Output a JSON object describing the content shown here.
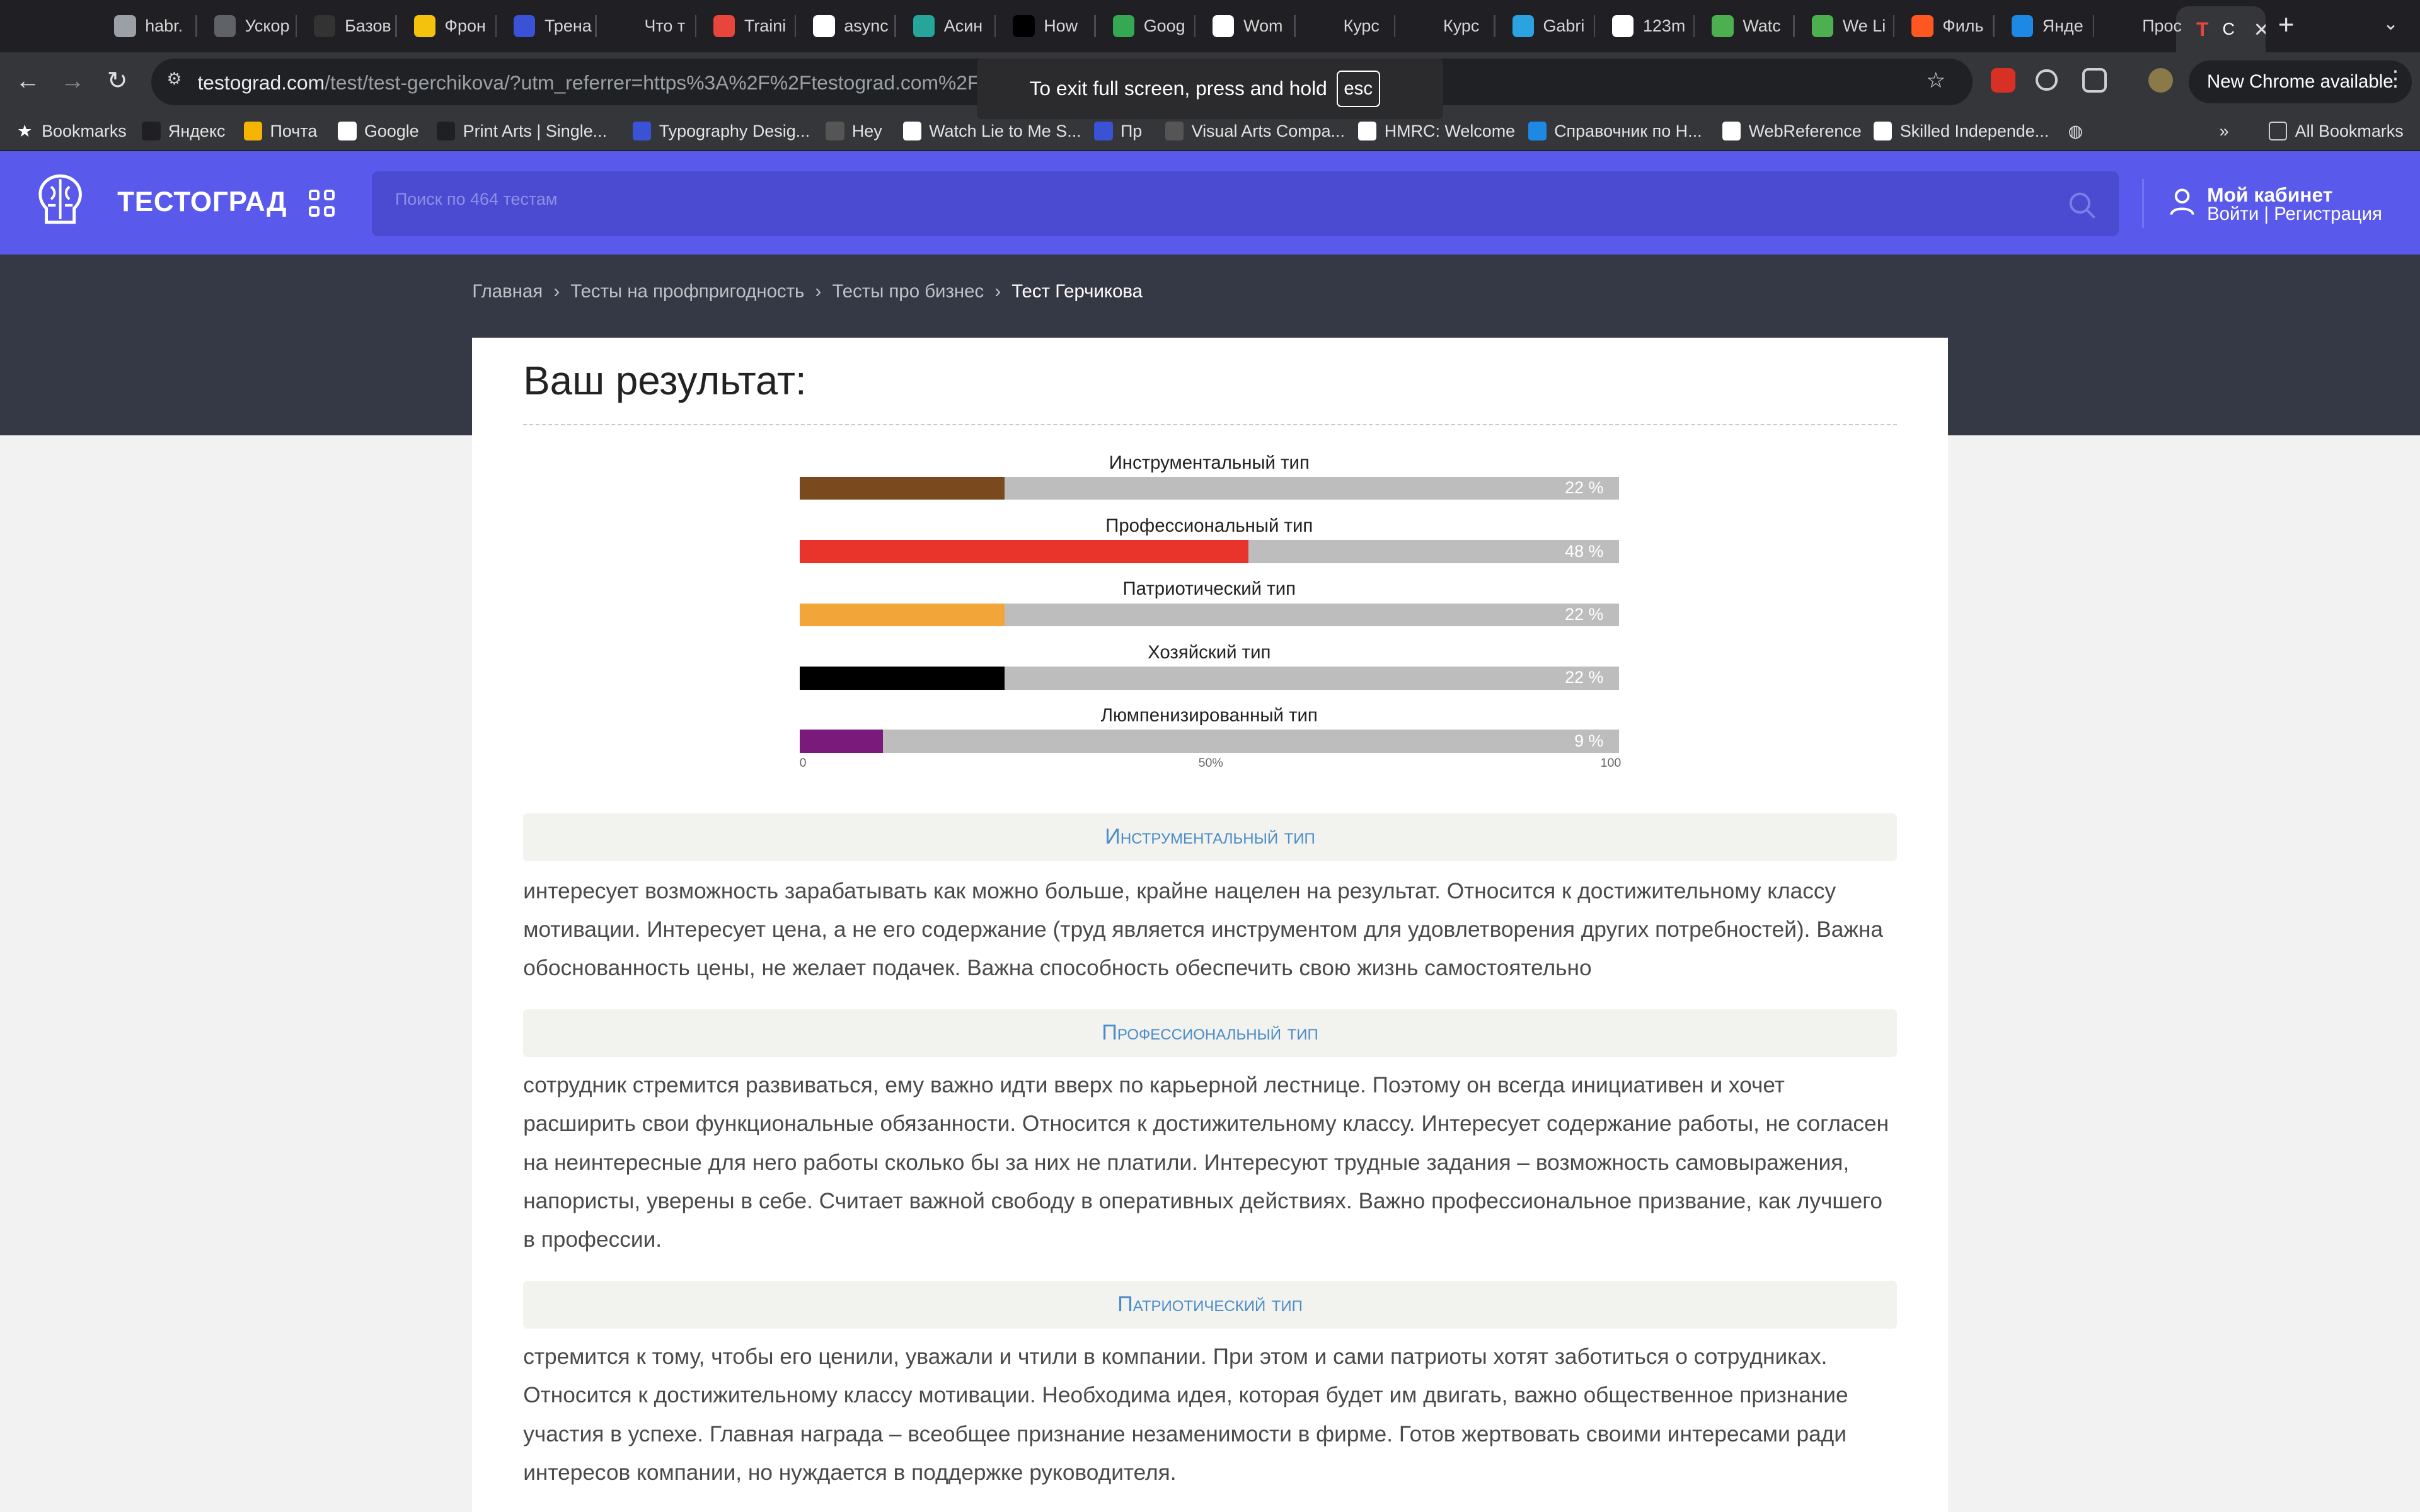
{
  "browser": {
    "tabs": [
      {
        "label": "habr.",
        "color": "#9aa0a6"
      },
      {
        "label": "Ускор",
        "color": "#5f6368"
      },
      {
        "label": "Базов",
        "color": "#333"
      },
      {
        "label": "Фрон",
        "color": "#f4c20d"
      },
      {
        "label": "Трена",
        "color": "#3a52d6"
      },
      {
        "label": "Что т",
        "color": "#1f1f24"
      },
      {
        "label": "Traini",
        "color": "#e8453c"
      },
      {
        "label": "async",
        "color": "#ffffff"
      },
      {
        "label": "Асин",
        "color": "#26a69a"
      },
      {
        "label": "How",
        "color": "#000000"
      },
      {
        "label": "Goog",
        "color": "#34a853"
      },
      {
        "label": "Wom",
        "color": "#ffffff"
      },
      {
        "label": "Курс",
        "color": "#1f1f24"
      },
      {
        "label": "Курс",
        "color": "#1f1f24"
      },
      {
        "label": "Gabri",
        "color": "#2aa3e0"
      },
      {
        "label": "123m",
        "color": "#ffffff"
      },
      {
        "label": "Watc",
        "color": "#4caf50"
      },
      {
        "label": "We Li",
        "color": "#4caf50"
      },
      {
        "label": "Филь",
        "color": "#ff5722"
      },
      {
        "label": "Янде",
        "color": "#1e88e5"
      },
      {
        "label": "Прос",
        "color": "#1f1f24"
      }
    ],
    "active_tab": {
      "label": "С",
      "favicon": "Т"
    },
    "url_host": "testograd.com",
    "url_path": "/test/test-gerchikova/?utm_referrer=https%3A%2F%2Ftestograd.com%2Ftest%2Fte",
    "new_chrome": "New Chrome available",
    "toast_text": "To exit full screen, press and hold",
    "toast_key": "esc",
    "bookmarks": [
      {
        "label": "Bookmarks",
        "icon": "star-icon"
      },
      {
        "label": "Яндекс",
        "icon": "yandex-icon"
      },
      {
        "label": "Почта",
        "icon": "mail-icon"
      },
      {
        "label": "Google",
        "icon": "google-icon"
      },
      {
        "label": "Print Arts | Single...",
        "icon": "print-icon"
      },
      {
        "label": "Typography Desig...",
        "icon": "typography-icon"
      },
      {
        "label": "Hey",
        "icon": "hey-icon"
      },
      {
        "label": "Watch Lie to Me S...",
        "icon": "globe-icon"
      },
      {
        "label": "Пр",
        "icon": "m-icon"
      },
      {
        "label": "Visual Arts Compa...",
        "icon": "plus-icon"
      },
      {
        "label": "HMRC: Welcome",
        "icon": "crown-icon"
      },
      {
        "label": "Справочник по H...",
        "icon": "dot-icon"
      },
      {
        "label": "WebReference",
        "icon": "wr-icon"
      },
      {
        "label": "Skilled Independe...",
        "icon": "doc-icon"
      }
    ],
    "all_bookmarks": "All Bookmarks"
  },
  "site": {
    "logo": "ТЕСТОГРАД",
    "search_placeholder": "Поиск по 464 тестам",
    "cabinet_title": "Мой кабинет",
    "cabinet_links": "Войти | Регистрация",
    "breadcrumbs": [
      "Главная",
      "Тесты на профпригодность",
      "Тесты про бизнес",
      "Тест Герчикова"
    ]
  },
  "result": {
    "title": "Ваш результат:"
  },
  "chart_data": {
    "type": "bar",
    "orientation": "horizontal",
    "categories": [
      "Инструментальный тип",
      "Профессиональный тип",
      "Патриотический тип",
      "Хозяйский тип",
      "Люмпенизированный тип"
    ],
    "values": [
      22,
      48,
      22,
      22,
      9
    ],
    "value_labels": [
      "22 %",
      "48 %",
      "22 %",
      "22 %",
      "9 %"
    ],
    "colors": [
      "#7a4a1e",
      "#e8342a",
      "#f2a63a",
      "#000000",
      "#7a1a7a"
    ],
    "xlim": [
      0,
      100
    ],
    "ticks": [
      "0",
      "50%",
      "100"
    ],
    "track_color": "#bdbdbd"
  },
  "sections": [
    {
      "heading": "Инструментальный тип",
      "text": "интересует возможность зарабатывать как можно больше, крайне нацелен на результат. Относится к достижительному классу мотивации. Интересует цена, а не его содержание (труд является инструментом для удовлетворения других потребностей). Важна обоснованность цены, не желает подачек. Важна способность обеспечить свою жизнь самостоятельно"
    },
    {
      "heading": "Профессиональный тип",
      "text": "сотрудник стремится развиваться, ему важно идти вверх по карьерной лестнице. Поэтому он всегда инициативен и хочет расширить свои функциональные обязанности. Относится к достижительному классу. Интересует содержание работы, не согласен на неинтересные для него работы сколько бы за них не платили. Интересуют трудные задания – возможность самовыражения, напористы, уверены в себе. Считает важной свободу в оперативных действиях. Важно профессиональное призвание, как лучшего в профессии."
    },
    {
      "heading": "Патриотический тип",
      "text": "стремится к тому, чтобы его ценили, уважали и чтили в компании. При этом и сами патриоты хотят заботиться о сотрудниках. Относится к достижительному классу мотивации. Необходима идея, которая будет им двигать, важно общественное признание участия в успехе. Главная награда – всеобщее признание незаменимости в фирме. Готов жертвовать своими интересами ради интересов компании, но нуждается в поддержке руководителя."
    }
  ]
}
